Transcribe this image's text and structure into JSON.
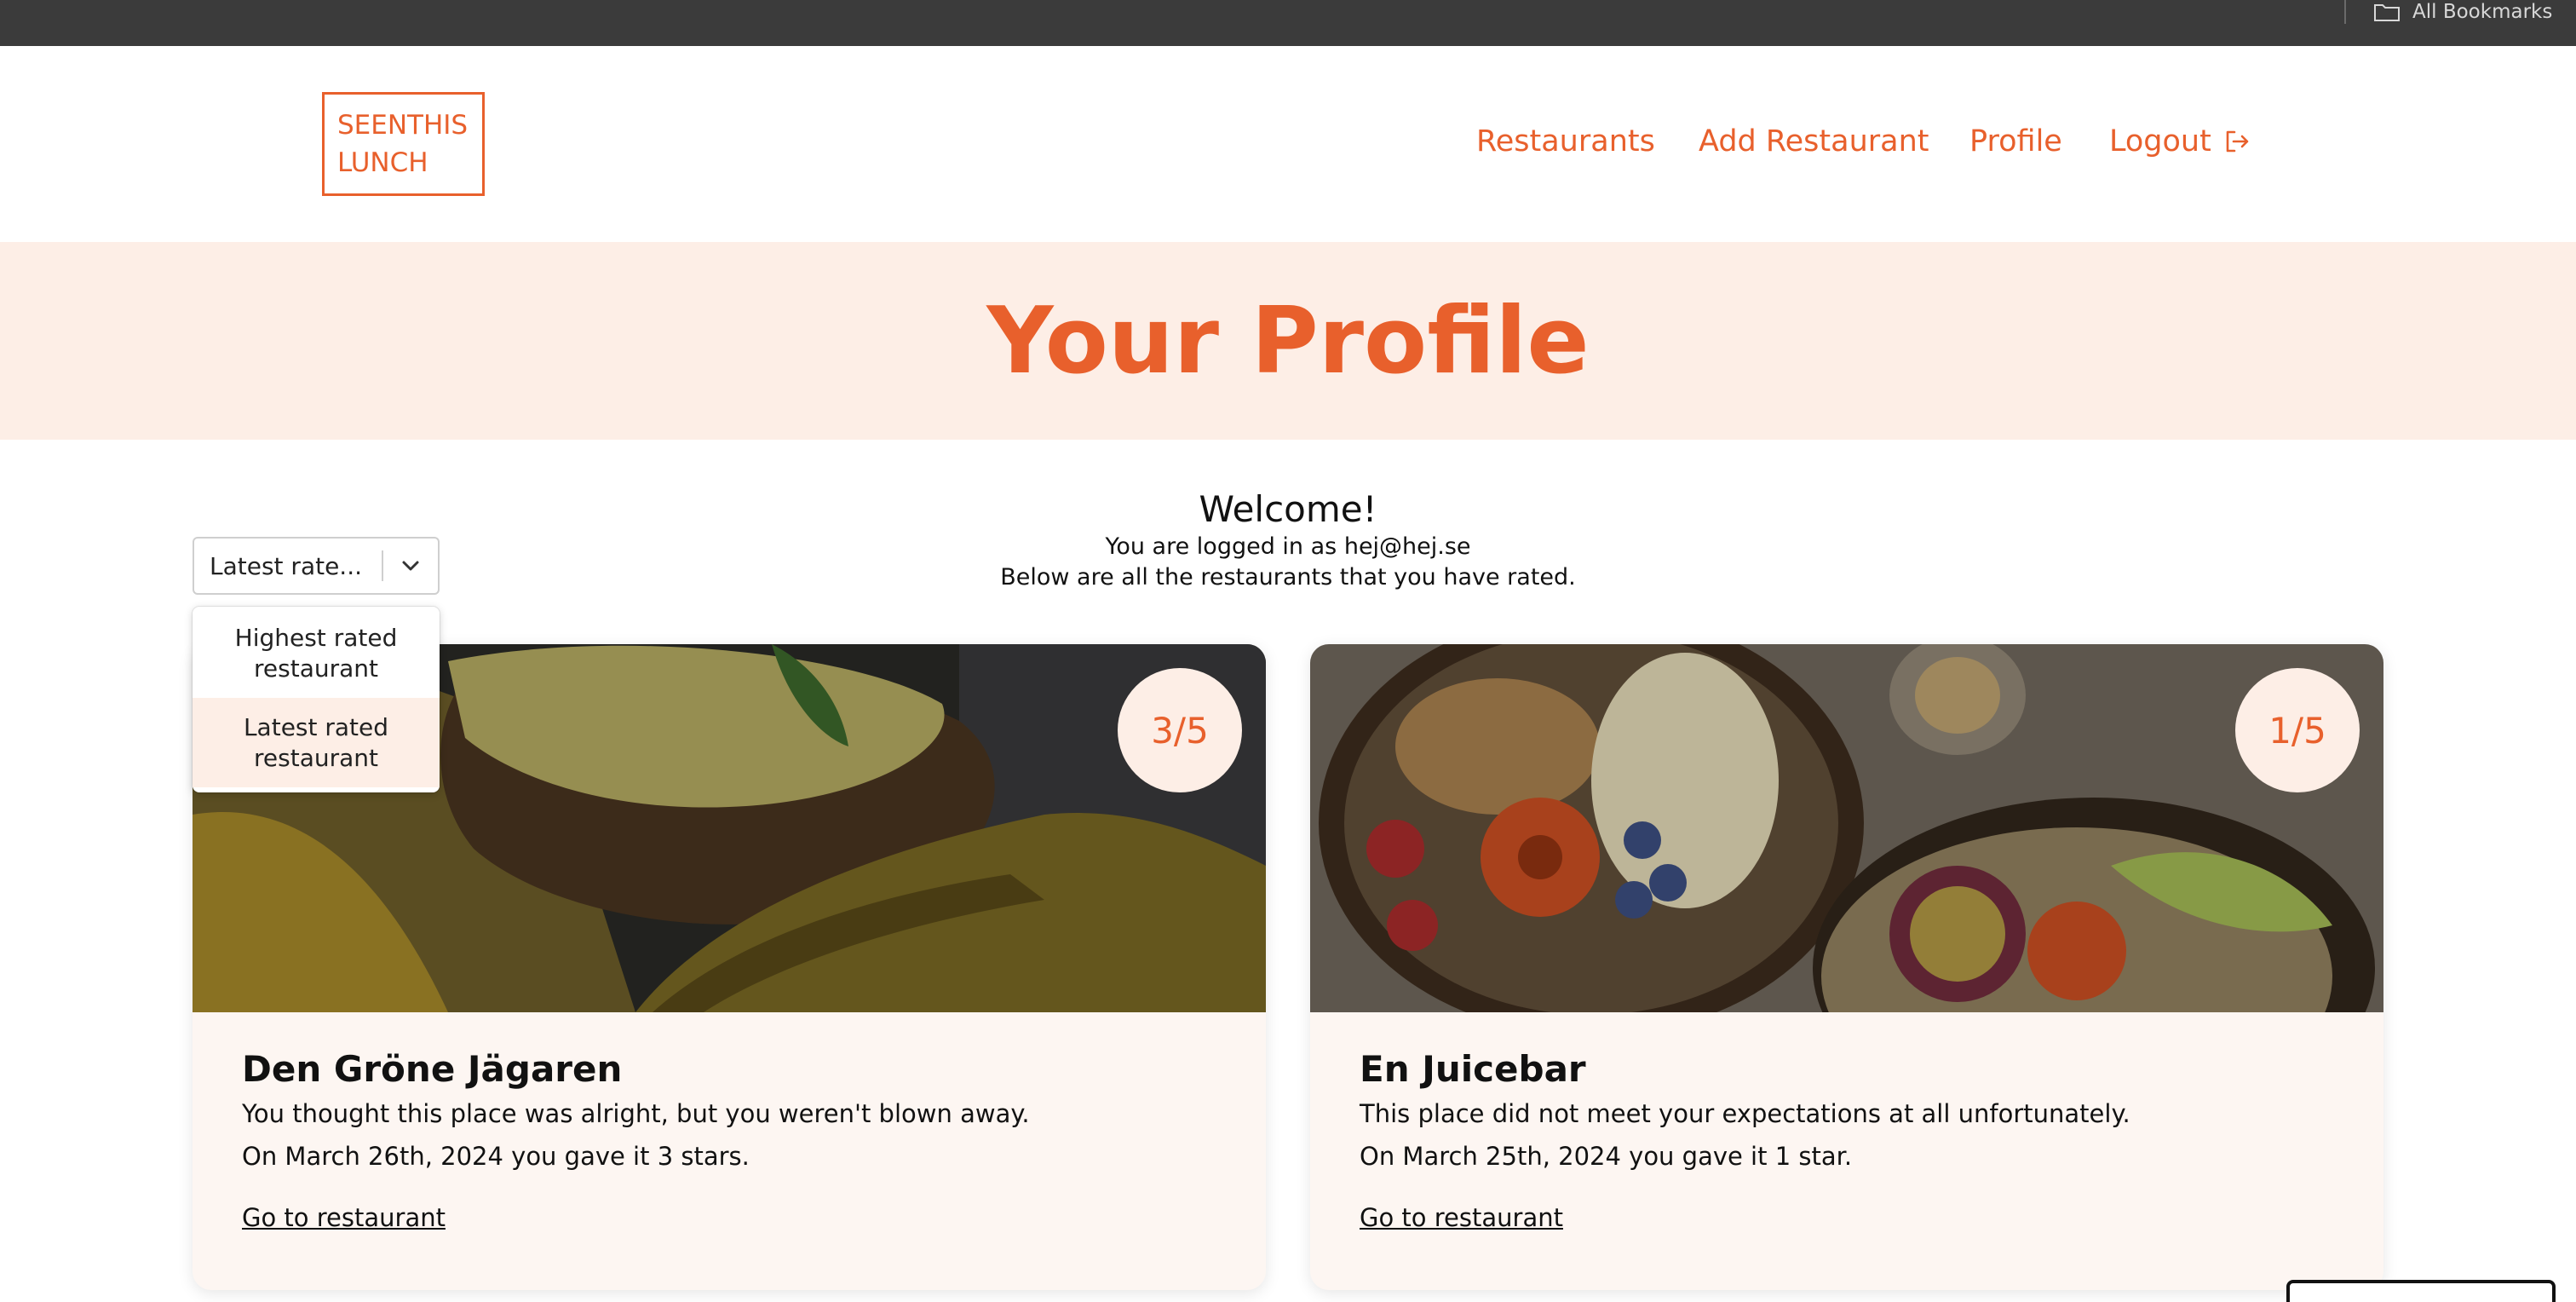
{
  "browser": {
    "bookmarks_label": "All Bookmarks"
  },
  "header": {
    "logo_line1": "SEENTHIS",
    "logo_line2": "LUNCH",
    "nav": {
      "restaurants": "Restaurants",
      "add_restaurant": "Add Restaurant",
      "profile": "Profile",
      "logout": "Logout"
    }
  },
  "hero": {
    "title": "Your Profile"
  },
  "welcome": {
    "title": "Welcome!",
    "logged_in": "You are logged in as hej@hej.se",
    "subtitle": "Below are all the restaurants that you have rated."
  },
  "sort": {
    "selected_display": "Latest rate...",
    "options": [
      {
        "label": "Highest rated restaurant",
        "selected": false
      },
      {
        "label": "Latest rated restaurant",
        "selected": true
      }
    ]
  },
  "cards": [
    {
      "rating": "3/5",
      "name": "Den Gröne Jägaren",
      "comment": "You thought this place was alright, but you weren't blown away.",
      "date_line": "On March 26th, 2024 you gave it 3 stars.",
      "link": "Go to restaurant"
    },
    {
      "rating": "1/5",
      "name": "En Juicebar",
      "comment": "This place did not meet your expectations at all unfortunately.",
      "date_line": "On March 25th, 2024 you gave it 1 star.",
      "link": "Go to restaurant"
    }
  ],
  "colors": {
    "accent": "#e8602c",
    "hero_bg": "#fdeee6",
    "card_bg": "#fdf6f2"
  }
}
